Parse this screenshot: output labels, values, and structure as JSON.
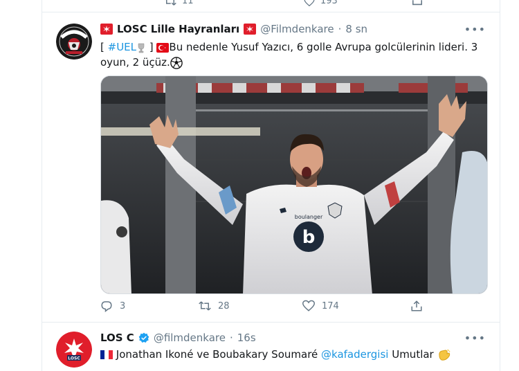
{
  "previous_tweet": {
    "retweet_count": "11",
    "like_count": "193"
  },
  "tweet1": {
    "display_name": "LOSC Lille Hayranları",
    "handle": "@Filmdenkare",
    "separator": "·",
    "time": "8 sn",
    "more": "•••",
    "text": {
      "open_bracket": "[ ",
      "hashtag": "#UEL",
      "close_bracket": " ]",
      "body": "Bu nedenle Yusuf Yazıcı, 6 golle Avrupa golcülerinin lideri. 3 oyun, 2 üçüz."
    },
    "image": {
      "jersey_sponsor": "boulanger",
      "avatar_text": "LOSC LILLE FANS"
    },
    "reply_count": "3",
    "retweet_count": "28",
    "like_count": "174"
  },
  "tweet2": {
    "display_name": "LOS C",
    "handle": "@filmdenkare",
    "separator": "·",
    "time": "16s",
    "more": "•••",
    "text_prefix": "Jonathan Ikoné ve Boubakary Soumaré ",
    "mention": "@kafadergisi",
    "text_suffix": " Umutlar",
    "avatar_text": "LOSC"
  },
  "colors": {
    "link": "#1b95e0",
    "muted": "#657786",
    "verified": "#1da1f2",
    "losc_red": "#e01e2b"
  }
}
